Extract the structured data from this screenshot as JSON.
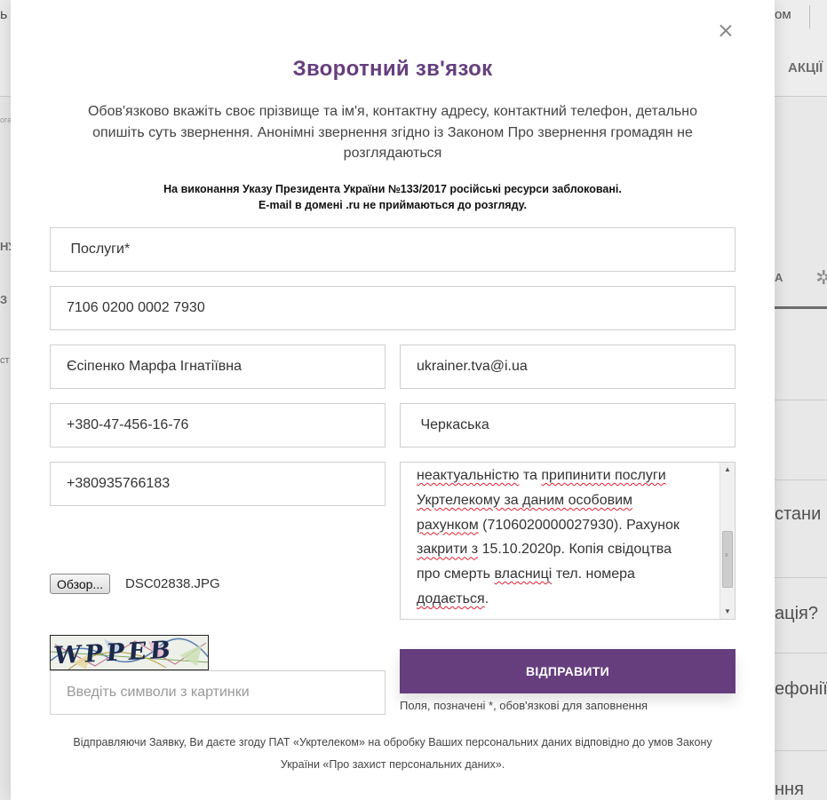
{
  "background": {
    "topbar_partial_left": "ь У",
    "topbar_partial_right": "ом",
    "nav_partial_right": "АКЦІЇ",
    "tab_partial_right": "А",
    "left_fragments": [
      "ога",
      "НУ",
      "З",
      "ст"
    ],
    "right_fragments": [
      "стани",
      "ація?",
      "ефонії.",
      "ння"
    ]
  },
  "modal": {
    "title": "Зворотний зв'язок",
    "description": "Обов'язково вкажіть своє прізвище та ім'я, контактну адресу, контактний телефон, детально опишіть суть звернення. Анонімні звернення згідно із Законом Про звернення громадян не розглядаються",
    "notice_line1": "На виконання Указу Президента України №133/2017 російські ресурси заблоковані.",
    "notice_line2": "E-mail в домені .ru не приймаються до розгляду.",
    "close_label": "×"
  },
  "form": {
    "service": " Послуги*",
    "account": "7106 0200 0002 7930",
    "full_name": "Єсіпенко Марфа Ігнатіївна",
    "email": "ukrainer.tva@i.ua",
    "phone": "+380-47-456-16-76",
    "region": " Черкаська",
    "mobile": "+380935766183",
    "message_lines": [
      [
        "неактуальністю",
        " та ",
        "припинити послуги"
      ],
      [
        "Укртелекому за ",
        "даним особовим"
      ],
      [
        "рахунком",
        " (7106020000027930). Рахунок"
      ],
      [
        "закрити з",
        " 15.10.2020р. Копія свідоцтва"
      ],
      [
        "про смерть ",
        "власниці",
        " тел. номера"
      ],
      [
        "додається",
        "."
      ]
    ],
    "browse_label": "Обзор...",
    "file_name": "DSC02838.JPG",
    "captcha_text": "WPPEB",
    "captcha_placeholder": "Введіть символи з картинки",
    "submit_label": "ВІДПРАВИТИ",
    "required_note": "Поля, позначені *, обов'язкові для заповнення",
    "consent_line1": "Відправляючи Заявку, Ви даєте згоду ПАТ «Укртелеком» на обробку Ваших персональних даних відповідно до умов Закону",
    "consent_line2": "України «Про захист персональних даних»."
  },
  "colors": {
    "accent": "#663e7e"
  }
}
